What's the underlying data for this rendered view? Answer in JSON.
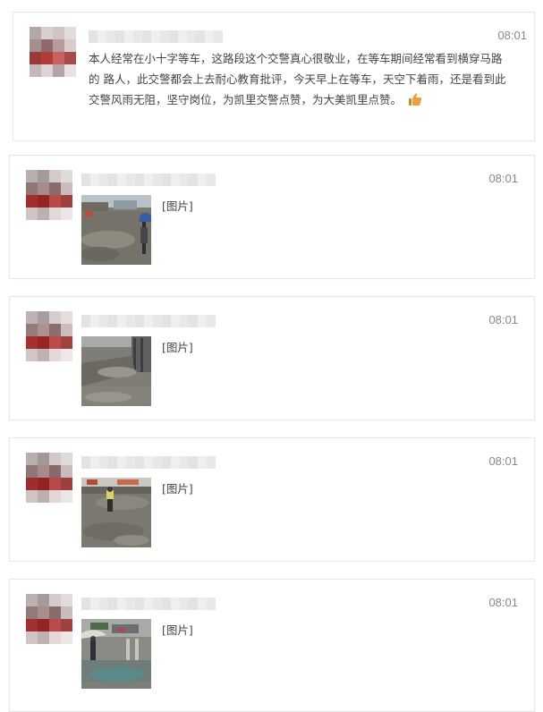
{
  "messages": [
    {
      "time": "08:01",
      "text": "本人经常在小十字等车，这路段这个交警真心很敬业，在等车期间经常看到横穿马路的 路人，此交警都会上去耐心教育批评，今天早上在等车，天空下着雨，还是看到此交警风雨无阻，坚守岗位，为凯里交警点赞，为大美凯里点赞。",
      "emoji": "thumbs-up-icon"
    },
    {
      "time": "08:01",
      "image_label": "[图片]"
    },
    {
      "time": "08:01",
      "image_label": "[图片]"
    },
    {
      "time": "08:01",
      "image_label": "[图片]"
    },
    {
      "time": "08:01",
      "image_label": "[图片]"
    }
  ],
  "colors": {
    "card_border": "#e6e6e6",
    "time_text": "#888888",
    "body_text": "#444444",
    "thumbs_up": "#e8a33c"
  }
}
